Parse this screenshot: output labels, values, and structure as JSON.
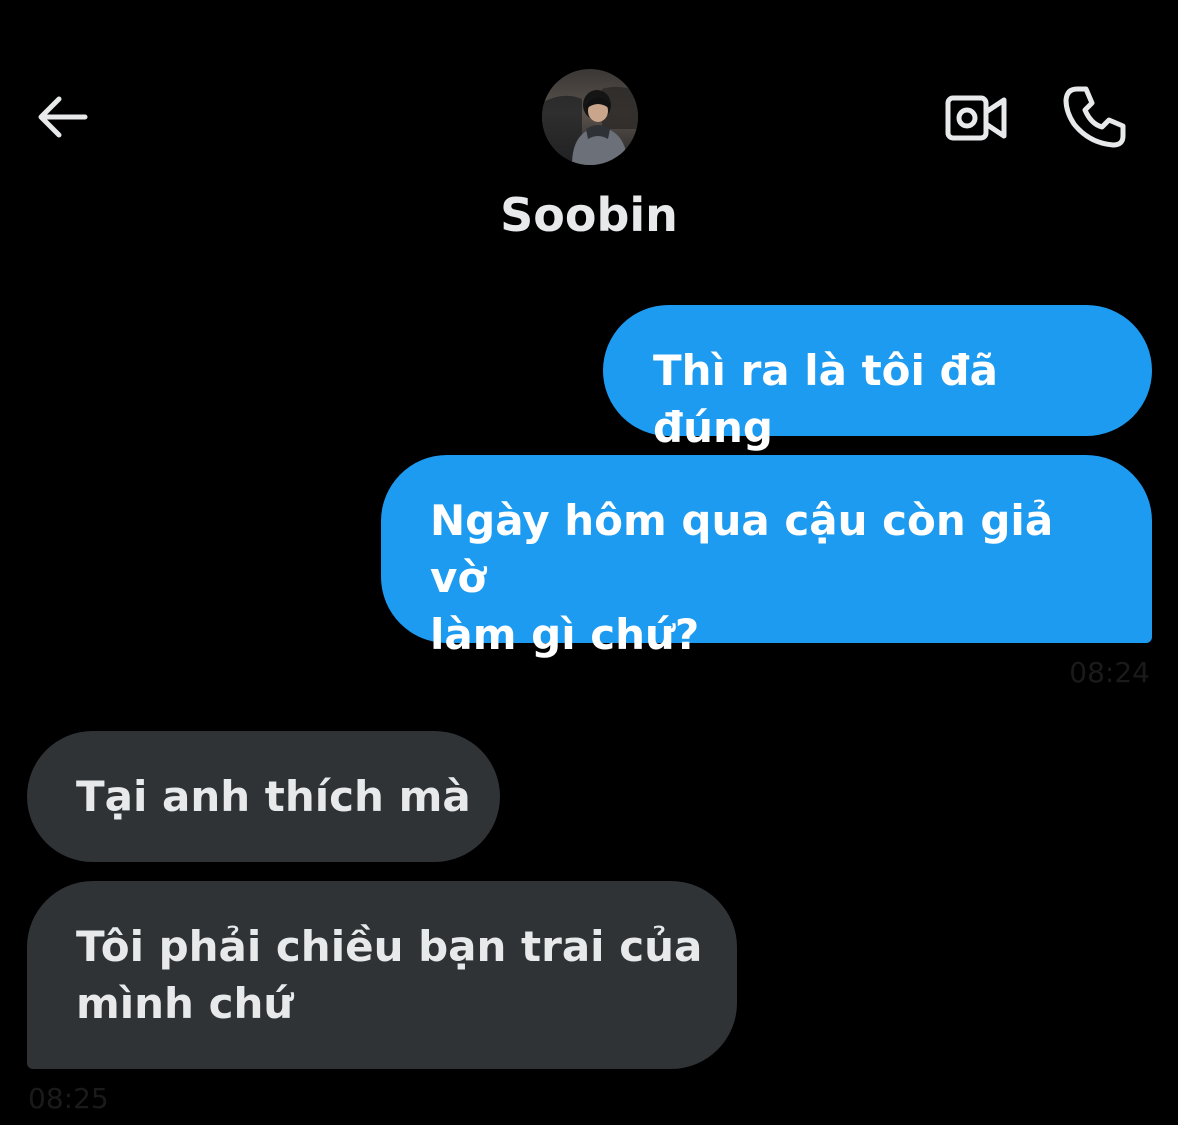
{
  "header": {
    "contact_name": "Soobin",
    "icons": {
      "back": "arrow-left-icon",
      "video": "video-camera-icon",
      "call": "phone-icon"
    }
  },
  "messages": [
    {
      "direction": "sent",
      "text": "Thì ra là tôi đã đúng"
    },
    {
      "direction": "sent",
      "text": "Ngày hôm qua cậu còn giả vờ\nlàm gì chứ?",
      "time": "08:24"
    },
    {
      "direction": "received",
      "text": "Tại anh thích mà"
    },
    {
      "direction": "received",
      "text": "Tôi phải chiều bạn trai của\nmình chứ",
      "time": "08:25"
    }
  ],
  "colors": {
    "background": "#000000",
    "sent_bubble": "#1d9bf0",
    "received_bubble": "#2f3336",
    "text": "#e7e9ea"
  }
}
